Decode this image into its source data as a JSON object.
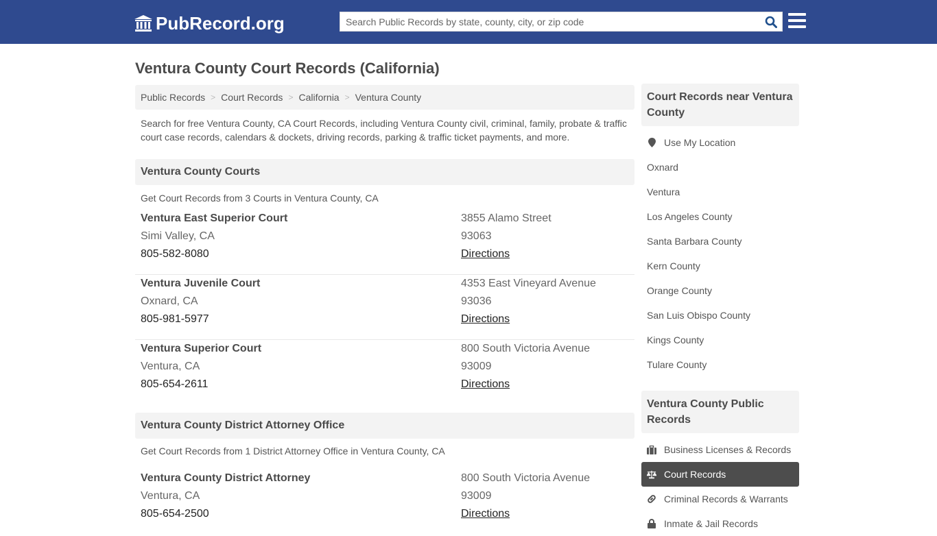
{
  "header": {
    "logo_text": "PubRecord.org",
    "search": {
      "placeholder": "Search Public Records by state, county, city, or zip code",
      "value": ""
    },
    "colors": {
      "brand": "#2f4a8f",
      "search_icon": "#1e4f8c"
    }
  },
  "page": {
    "title": "Ventura County Court Records (California)",
    "breadcrumb": [
      "Public Records",
      "Court Records",
      "California",
      "Ventura County"
    ],
    "intro": "Search for free Ventura County, CA Court Records, including Ventura County civil, criminal, family, probate & traffic court case records, calendars & dockets, driving records, parking & traffic ticket payments, and more."
  },
  "sections": [
    {
      "title": "Ventura County Courts",
      "subtitle": "Get Court Records from 3 Courts in Ventura County, CA",
      "entries": [
        {
          "name": "Ventura East Superior Court",
          "city": "Simi Valley, CA",
          "phone": "805-582-8080",
          "address": "3855 Alamo Street",
          "zip": "93063",
          "directions": "Directions"
        },
        {
          "name": "Ventura Juvenile Court",
          "city": "Oxnard, CA",
          "phone": "805-981-5977",
          "address": "4353 East Vineyard Avenue",
          "zip": "93036",
          "directions": "Directions"
        },
        {
          "name": "Ventura Superior Court",
          "city": "Ventura, CA",
          "phone": "805-654-2611",
          "address": "800 South Victoria Avenue",
          "zip": "93009",
          "directions": "Directions"
        }
      ]
    },
    {
      "title": "Ventura County District Attorney Office",
      "subtitle": "Get Court Records from 1 District Attorney Office in Ventura County, CA",
      "entries": [
        {
          "name": "Ventura County District Attorney",
          "city": "Ventura, CA",
          "phone": "805-654-2500",
          "address": "800 South Victoria Avenue",
          "zip": "93009",
          "directions": "Directions"
        }
      ]
    }
  ],
  "sidebar": {
    "nearby": {
      "title": "Court Records near Ventura County",
      "use_location": "Use My Location",
      "items": [
        "Oxnard",
        "Ventura",
        "Los Angeles County",
        "Santa Barbara County",
        "Kern County",
        "Orange County",
        "San Luis Obispo County",
        "Kings County",
        "Tulare County"
      ]
    },
    "public_records": {
      "title": "Ventura County Public Records",
      "items": [
        {
          "label": "Business Licenses & Records",
          "icon": "briefcase-icon",
          "active": false
        },
        {
          "label": "Court Records",
          "icon": "scales-icon",
          "active": true
        },
        {
          "label": "Criminal Records & Warrants",
          "icon": "link-icon",
          "active": false
        },
        {
          "label": "Inmate & Jail Records",
          "icon": "lock-icon",
          "active": false
        }
      ]
    }
  }
}
